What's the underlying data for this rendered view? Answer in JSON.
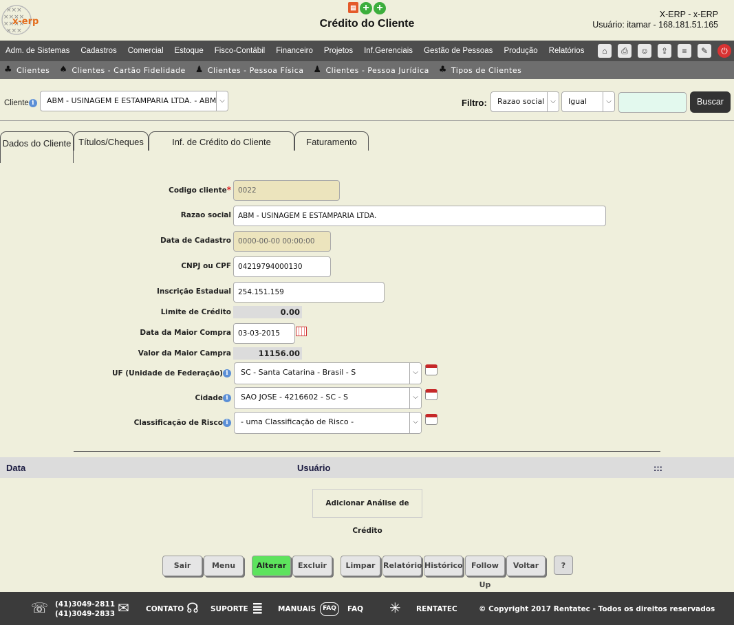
{
  "app": {
    "logo_text": "x-erp",
    "page_title": "Crédito do Cliente",
    "user_line1": "X-ERP - x-ERP",
    "user_line2": "Usuário: itamar - 168.181.51.165"
  },
  "menu": {
    "items": [
      "Adm. de Sistemas",
      "Cadastros",
      "Comercial",
      "Estoque",
      "Fisco-Contábil",
      "Financeiro",
      "Projetos",
      "Inf.Gerenciais",
      "Gestão de Pessoas",
      "Produção",
      "Relatórios"
    ]
  },
  "submenu": {
    "items": [
      "Clientes",
      "Clientes - Cartão Fidelidade",
      "Clientes - Pessoa Física",
      "Clientes - Pessoa Jurídica",
      "Tipos de Clientes"
    ]
  },
  "client_selector": {
    "label": "Cliente",
    "value": "ABM - USINAGEM E ESTAMPARIA LTDA. - ABM - (",
    "filtro_label": "Filtro:",
    "filtro_field": "Razao social",
    "filtro_op": "Igual",
    "filtro_value": "",
    "search_button": "Buscar"
  },
  "tabs": [
    "Dados do Cliente",
    "Títulos/Cheques",
    "Inf. de Crédito do Cliente",
    "Faturamento"
  ],
  "form": {
    "codigo_label": "Codigo cliente",
    "codigo_value": "0022",
    "razao_label": "Razao social",
    "razao_value": "ABM - USINAGEM E ESTAMPARIA LTDA.",
    "data_cadastro_label": "Data de Cadastro",
    "data_cadastro_value": "0000-00-00 00:00:00",
    "cnpj_label": "CNPJ ou CPF",
    "cnpj_value": "04219794000130",
    "ie_label": "Inscrição Estadual",
    "ie_value": "254.151.159",
    "limite_label": "Limite de Crédito",
    "limite_value": "0.00",
    "data_maior_label": "Data da Maior Compra",
    "data_maior_value": "03-03-2015",
    "valor_maior_label": "Valor da Maior Campra",
    "valor_maior_value": "11156.00",
    "uf_label": "UF (Unidade de Federação)",
    "uf_value": "SC - Santa Catarina - Brasil - S",
    "cidade_label": "Cidade",
    "cidade_value": "SAO JOSE - 4216602 - SC - S",
    "risco_label": "Classificação de Risco",
    "risco_value": "- uma Classificação de Risco -"
  },
  "grid": {
    "col_data": "Data",
    "col_usuario": "Usuário",
    "col_menu": ":::",
    "add_button": "Adicionar Análise de Crédito"
  },
  "actions": [
    "Sair",
    "Menu",
    "Alterar",
    "Excluir",
    "Limpar",
    "Relatório",
    "Histórico",
    "Follow Up",
    "Voltar",
    "?"
  ],
  "footer": {
    "phone1": "(41)3049-2811",
    "phone2": "(41)3049-2833",
    "contato": "CONTATO",
    "suporte": "SUPORTE",
    "manuais": "MANUAIS",
    "faq_badge": "FAQ",
    "faq": "FAQ",
    "rentatec": "RENTATEC",
    "copyright": "© Copyright 2017 Rentatec - Todos os direitos reservados"
  },
  "colors": {
    "background": "#efefdc",
    "menubar": "#4d4d4d",
    "submenu": "#6e6e6e",
    "footer": "#3b3b3b",
    "alterar_button": "#5de35d",
    "readonly_field": "#ece4bd"
  }
}
